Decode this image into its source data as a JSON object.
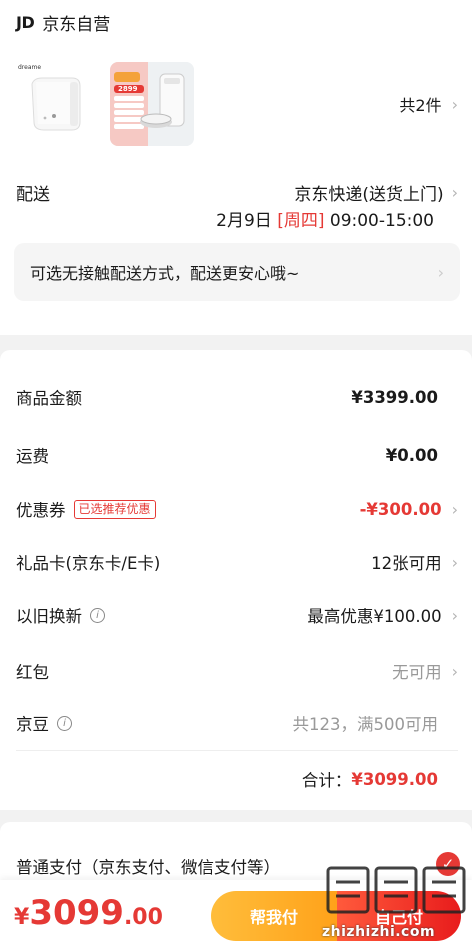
{
  "store": {
    "logo": "JD",
    "name": "京东自营"
  },
  "products": {
    "brand": "dreame",
    "price_tag": "2899",
    "count_label": "共2件"
  },
  "shipping": {
    "label": "配送",
    "method": "京东快递(送货上门)",
    "date": "2月9日",
    "weekday": "[周四]",
    "time": "09:00-15:00",
    "tip": "可选无接触配送方式，配送更安心哦~"
  },
  "summary": {
    "goods_amount": {
      "label": "商品金额",
      "value": "¥3399.00"
    },
    "freight": {
      "label": "运费",
      "value": "¥0.00"
    },
    "coupon": {
      "label": "优惠券",
      "tag": "已选推荐优惠",
      "value": "-¥300.00"
    },
    "gift_card": {
      "label": "礼品卡(京东卡/E卡)",
      "value": "12张可用"
    },
    "trade_in": {
      "label": "以旧换新",
      "value": "最高优惠¥100.00"
    },
    "red_packet": {
      "label": "红包",
      "value": "无可用"
    },
    "jingdou": {
      "label": "京豆",
      "value": "共123，满500可用"
    },
    "total": {
      "label": "合计：",
      "value": "¥3099.00"
    }
  },
  "payment": {
    "label": "普通支付（京东支付、微信支付等）"
  },
  "footer": {
    "currency": "¥",
    "amount_int": "3099",
    "amount_dec": ".00",
    "help_pay": "帮我付",
    "self_pay": "自己付"
  },
  "watermark": {
    "text": "zhizhizhi.com"
  },
  "colors": {
    "accent_red": "#e53935",
    "button_orange": "#ffa21a",
    "button_red": "#e81c1c"
  }
}
